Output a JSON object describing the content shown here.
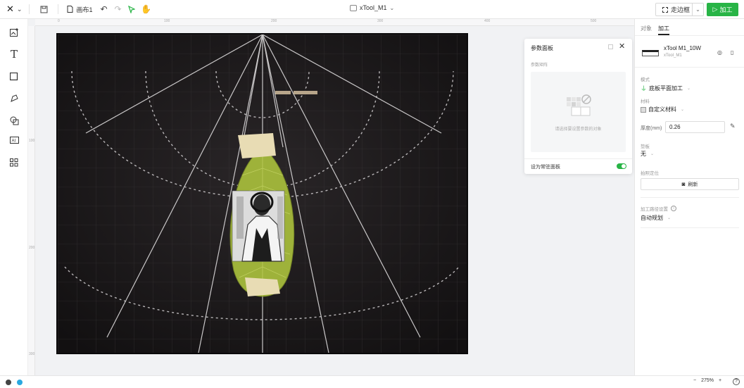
{
  "topbar": {
    "canvas_name": "画布1",
    "device_name": "xTool_M1",
    "frame_label": "走边框",
    "process_label": "加工"
  },
  "ruler": {
    "top_ticks": [
      "0",
      "100",
      "200",
      "300",
      "400",
      "500"
    ],
    "left_ticks": [
      "100",
      "200",
      "300"
    ]
  },
  "param_panel": {
    "title": "参数面板",
    "section_label": "参数矩阵",
    "empty_hint": "请选择要设置参数的对象",
    "toggle_label": "设为常驻面板",
    "toggle_on": true
  },
  "right_panel": {
    "tabs": [
      {
        "label": "对象"
      },
      {
        "label": "加工"
      }
    ],
    "active_tab": "加工",
    "machine_name": "xTool M1_10W",
    "machine_model": "xTool_M1",
    "mode_label": "模式",
    "mode_value": "底板平面加工",
    "material_label": "材料",
    "material_value": "自定义材料",
    "thickness_label": "厚度(mm)",
    "thickness_value": "0.26",
    "fixture_label": "垫板",
    "fixture_value": "无",
    "camera_label": "拍照定位",
    "refresh_label": "刷新",
    "path_label": "加工路径设置",
    "path_value": "自动规划"
  },
  "bottombar": {
    "zoom_value": "275%",
    "zoom_out": "−",
    "zoom_in": "+",
    "help": "?"
  },
  "colors": {
    "accent_green": "#28b446",
    "canvas_bg": "#1b181a",
    "leaf_fill": "#9eb23a",
    "tape": "#e8dcb4"
  }
}
